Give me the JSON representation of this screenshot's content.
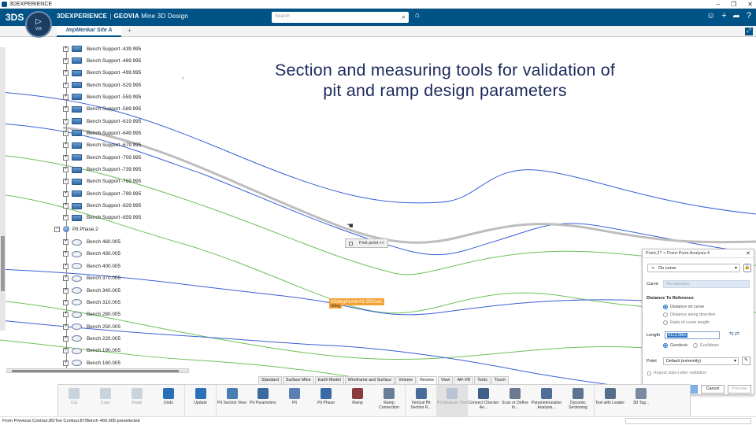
{
  "os": {
    "title": "3DEXPERIENCE",
    "controls": [
      "–",
      "❐",
      "✕"
    ]
  },
  "header": {
    "logo": "3DS",
    "brand_main": "3DEXPERIENCE",
    "brand_sep": "|",
    "brand_product": "GEOVIA",
    "brand_app": "Mine 3D Design",
    "search_placeholder": "Search",
    "compass_label": "V,R",
    "accent": "#005386"
  },
  "tabs": [
    {
      "label": "ImpMenkar Site A"
    }
  ],
  "overlay_title": {
    "line1": "Section and measuring tools for validation of",
    "line2": "pit and ramp design parameters"
  },
  "tree": {
    "supports": [
      "Bench Support -439.995",
      "Bench Support -469.995",
      "Bench Support -499.995",
      "Bench Support -529.995",
      "Bench Support -559.995",
      "Bench Support -589.995",
      "Bench Support -619.995",
      "Bench Support -649.995",
      "Bench Support -679.995",
      "Bench Support -709.995",
      "Bench Support -739.995",
      "Bench Support -769.995",
      "Bench Support -799.995",
      "Bench Support -829.995",
      "Bench Support -859.995"
    ],
    "phase": "Pit Phase.2",
    "benches": [
      "Bench 460.005",
      "Bench 430.005",
      "Bench 400.005",
      "Bench 370.005",
      "Bench 340.005",
      "Bench 310.005",
      "Bench 280.005",
      "Bench 250.005",
      "Bench 220.005",
      "Bench 190.005",
      "Bench 160.005"
    ]
  },
  "canvas": {
    "first_point": "First point >>",
    "angle": "60deg41min41.992sec",
    "angle_sub": "0deg"
  },
  "dialog": {
    "title": "Point.27 < Point-Point Analysis.4",
    "mode": "On curve",
    "curve_label": "Curve",
    "curve_value": "No selection",
    "section_title": "Distance To Reference",
    "radios": [
      "Distance on curve",
      "Distance along direction",
      "Ratio of curve length"
    ],
    "length_label": "Length",
    "length_value": "6113.98m",
    "geo_options": [
      "Geodesic",
      "Euclidean"
    ],
    "point_label": "Point",
    "point_value": "Default (extremity)",
    "repeat_label": "Repeat object after validation",
    "ok": "OK",
    "cancel": "Cancel",
    "preview": "Preview"
  },
  "section_tabs": [
    "Standard",
    "Surface Mine",
    "Earth Model",
    "Wireframe and Surface",
    "Volume",
    "Review",
    "View",
    "AR-VR",
    "Tools",
    "Touch"
  ],
  "active_section": "Review",
  "actions": [
    {
      "label": "Cut",
      "dim": true
    },
    {
      "label": "Copy",
      "dim": true
    },
    {
      "label": "Paste",
      "dim": true
    },
    {
      "label": "Undo",
      "dim": false
    },
    {
      "label": "Update",
      "dim": false
    },
    {
      "label": "Pit Section View",
      "dim": false
    },
    {
      "label": "Pit Parameters",
      "dim": false
    },
    {
      "label": "Pit",
      "dim": false
    },
    {
      "label": "Pit Phase",
      "dim": false
    },
    {
      "label": "Ramp",
      "dim": false
    },
    {
      "label": "Ramp Connection",
      "dim": false
    },
    {
      "label": "Vertical Pit Section R...",
      "dim": false
    },
    {
      "label": "Pit Measure Tool",
      "dim": true
    },
    {
      "label": "Connect Checker An...",
      "dim": false
    },
    {
      "label": "Scan or Define In...",
      "dim": false
    },
    {
      "label": "Parameterization Analysis...",
      "dim": false
    },
    {
      "label": "Dynamic Sectioning",
      "dim": false
    },
    {
      "label": "Text with Leader",
      "dim": false
    },
    {
      "label": "3D Tag...",
      "dim": false
    }
  ],
  "status": "From Previous Contour.85/Toe Contour.87/Bench 460.005 preselected"
}
